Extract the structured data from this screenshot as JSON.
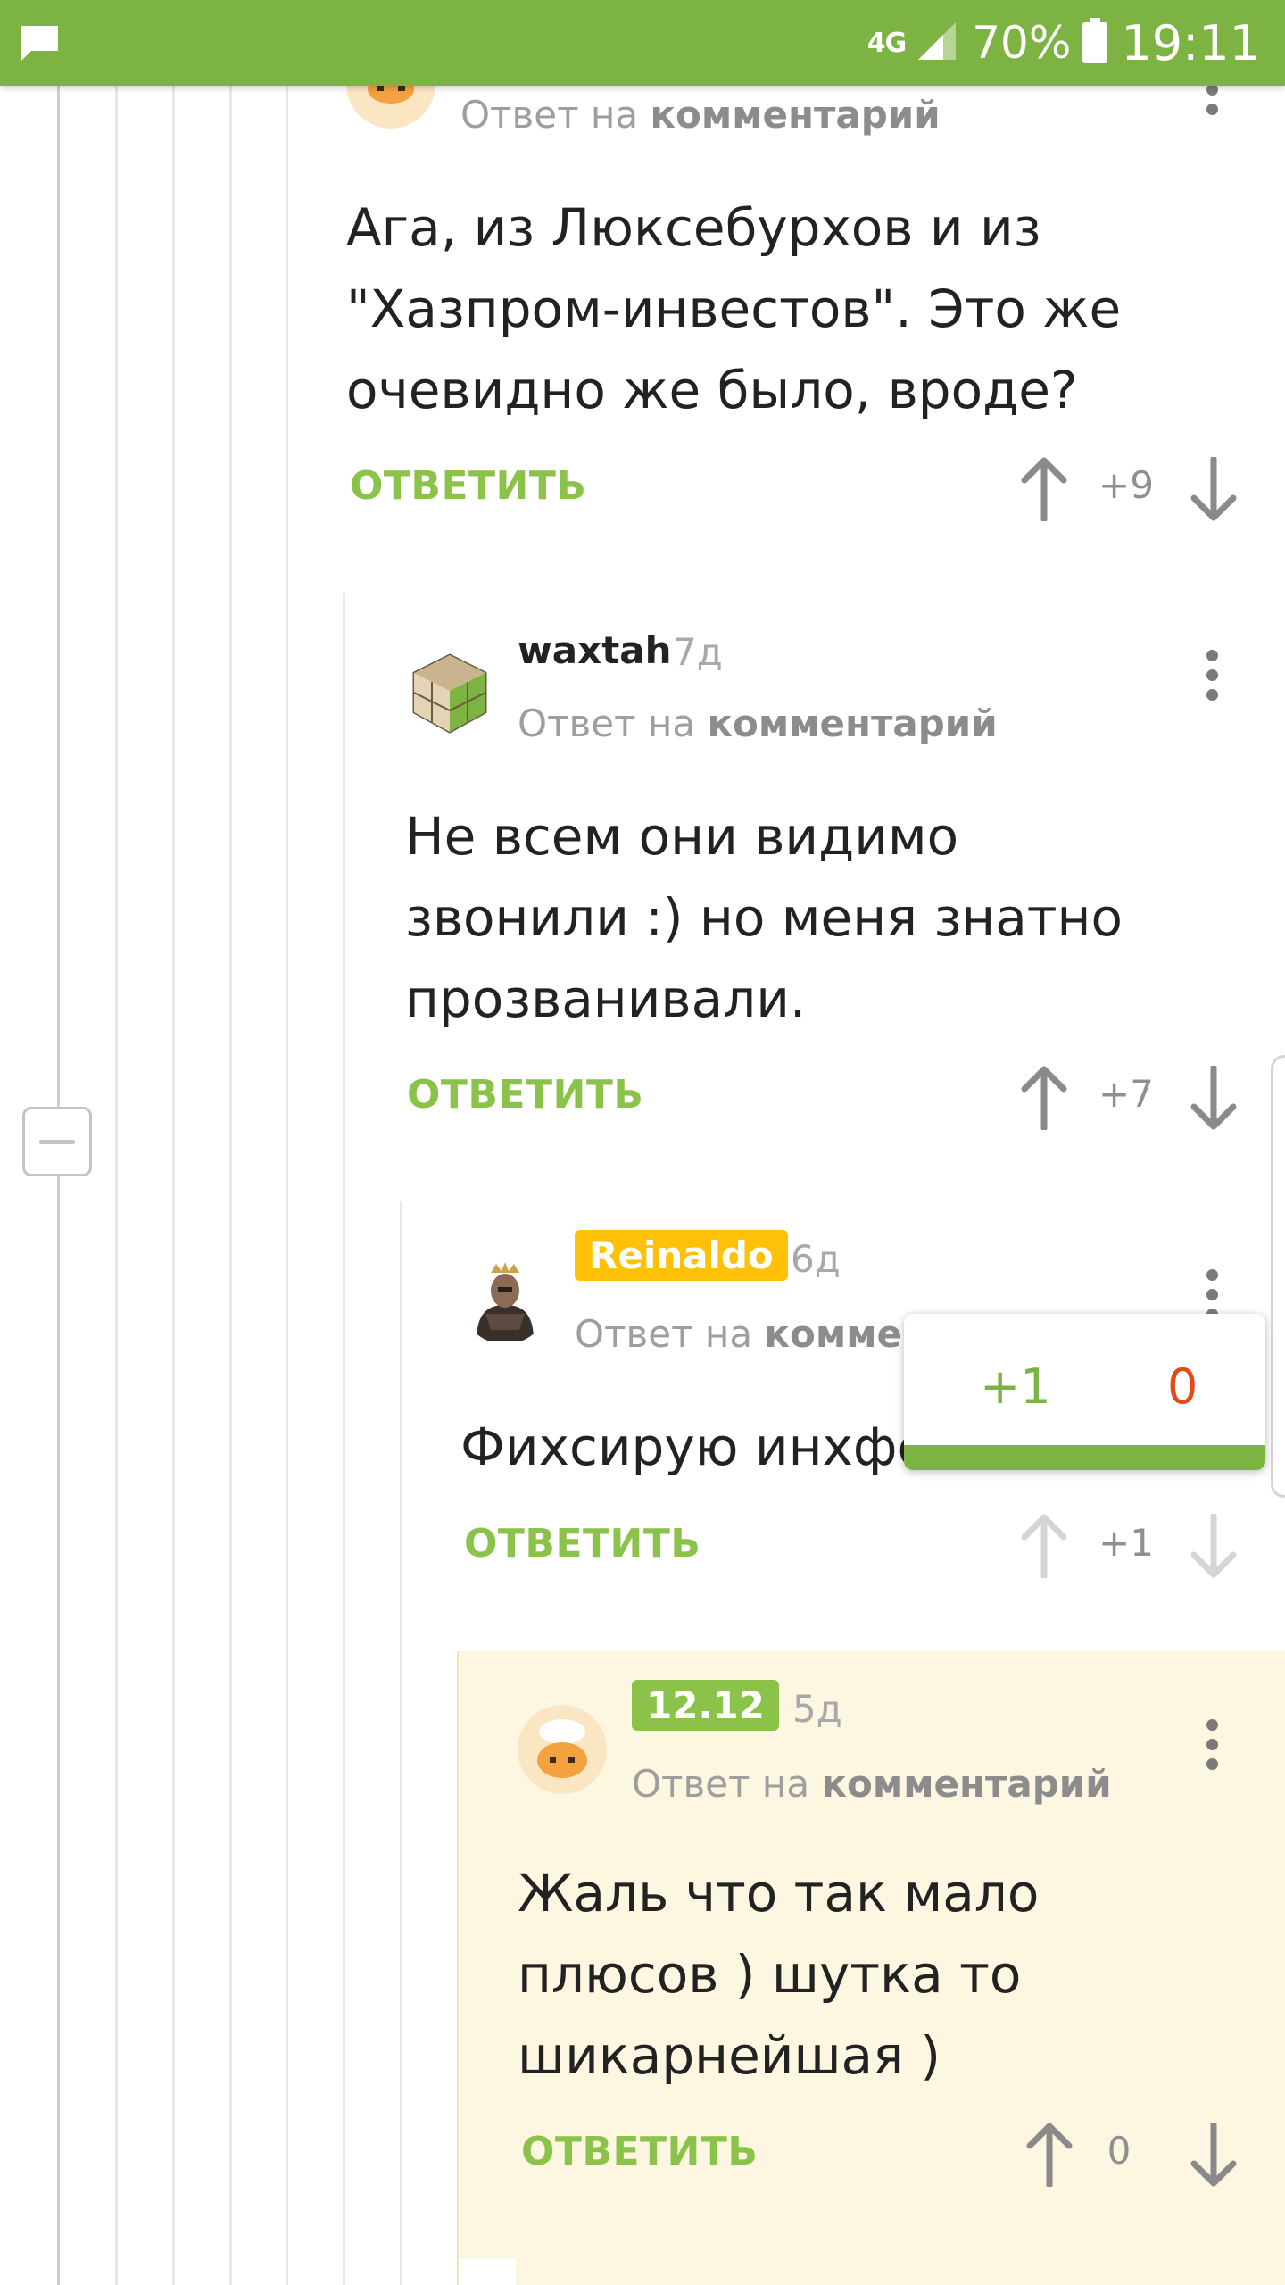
{
  "colors": {
    "brand_green": "#7cb342",
    "reply_green": "#8bc34a",
    "badge_gold": "#ffc107",
    "badge_green": "#8bc34a",
    "highlight_bg": "#fdf6e1",
    "minus_red": "#e64a19"
  },
  "status_bar": {
    "network": "4G",
    "battery": "70%",
    "time": "19:11",
    "icons": [
      "message-icon",
      "signal-icon",
      "battery-icon"
    ]
  },
  "comments": [
    {
      "reply_prefix": "Ответ на",
      "reply_target": "комментарий",
      "lines": [
        "Ага, из Люксебурхов и из",
        "\"Хазпром-инвестов\". Это же",
        "очевидно же было, вроде?"
      ],
      "reply_label": "ОТВЕТИТЬ",
      "score": "+9"
    },
    {
      "author": "waxtah",
      "age": "7д",
      "reply_prefix": "Ответ на",
      "reply_target": "комментарий",
      "lines": [
        "Не всем они видимо",
        "звонили :) но меня знатно",
        "прозванивали."
      ],
      "reply_label": "ОТВЕТИТЬ",
      "score": "+7"
    },
    {
      "author": "Reinaldo",
      "age": "6д",
      "reply_prefix": "Ответ на",
      "reply_target": "коммен",
      "lines": [
        "Фихсирую инхфо"
      ],
      "reply_label": "ОТВЕТИТЬ",
      "score": "+1"
    },
    {
      "author": "12.12",
      "age": "5д",
      "reply_prefix": "Ответ на",
      "reply_target": "комментарий",
      "lines": [
        "Жаль что так мало",
        "плюсов ) шутка то",
        "шикарнейшая )"
      ],
      "reply_label": "ОТВЕТИТЬ",
      "score": "0"
    }
  ],
  "rating_popup": {
    "plus": "+1",
    "minus": "0"
  }
}
